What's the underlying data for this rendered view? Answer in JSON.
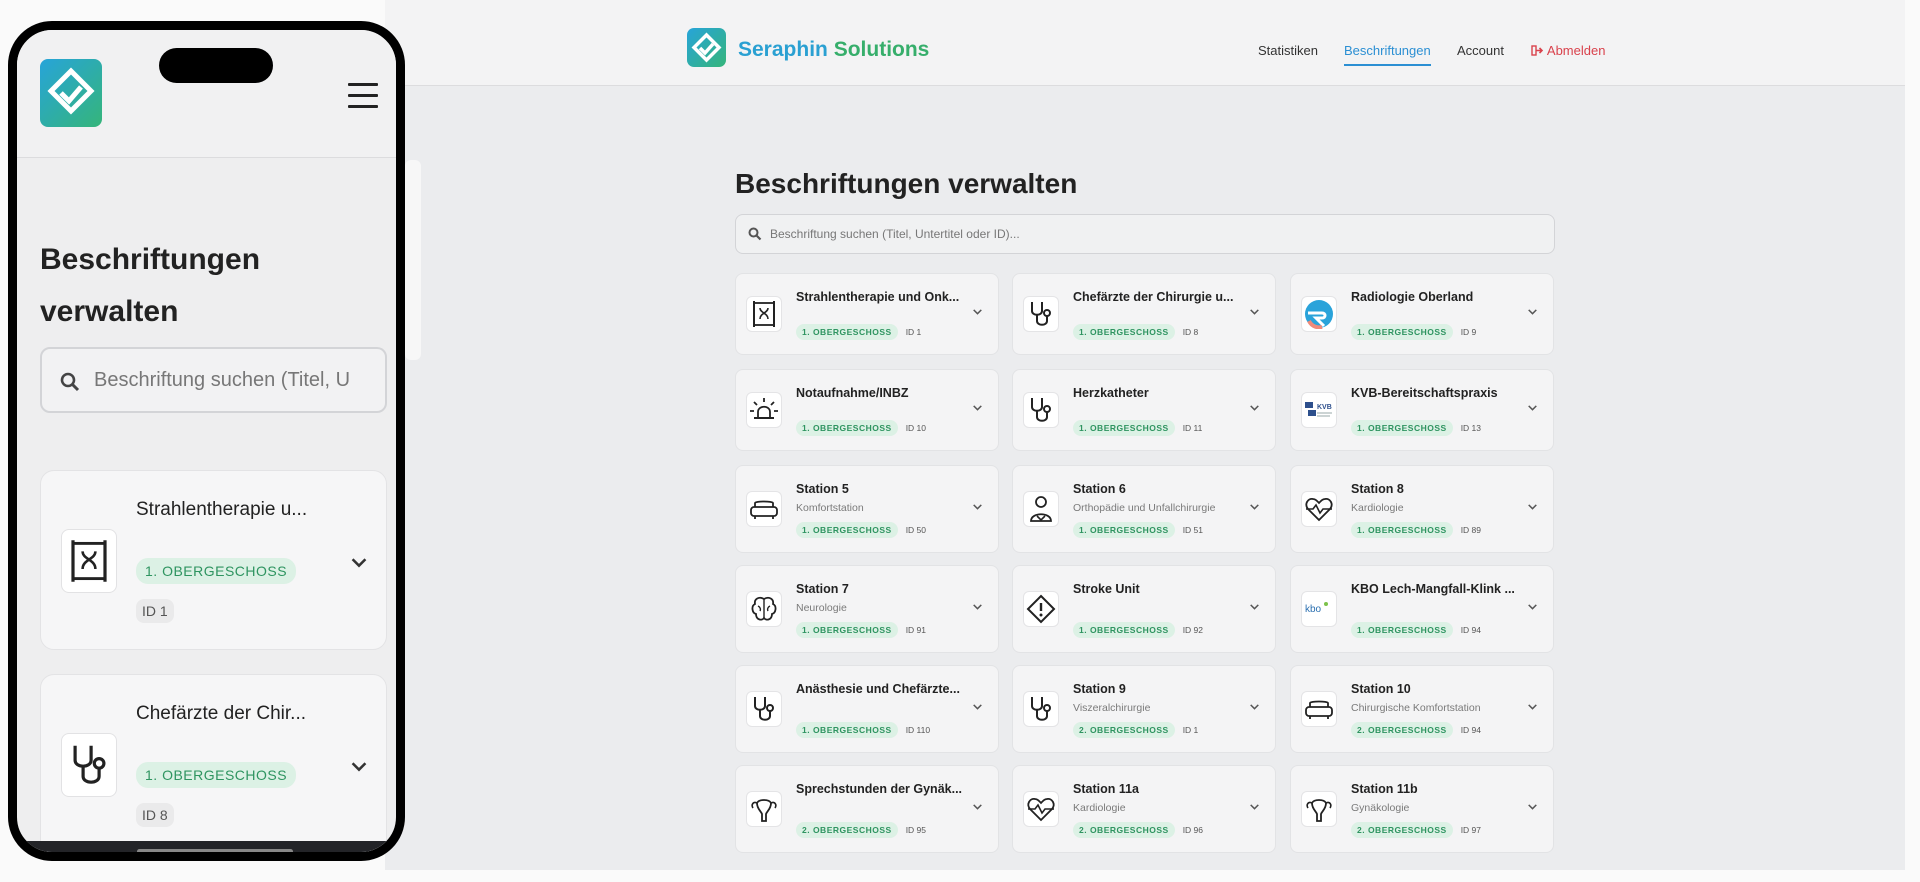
{
  "app": {
    "brand_part1": "Seraphin",
    "brand_part2": "Solutions"
  },
  "nav": {
    "statistiken": "Statistiken",
    "beschriftungen": "Beschriftungen",
    "account": "Account",
    "abmelden": "Abmelden"
  },
  "main": {
    "title": "Beschriftungen verwalten",
    "search_placeholder": "Beschriftung suchen (Titel, Untertitel oder ID)..."
  },
  "cards": [
    {
      "icon": "radiotherapy-icon",
      "title": "Strahlentherapie und Onk...",
      "subtitle": "",
      "floor": "1. OBERGESCHOSS",
      "id": "ID 1"
    },
    {
      "icon": "stethoscope-icon",
      "title": "Chefärzte der Chirurgie u...",
      "subtitle": "",
      "floor": "1. OBERGESCHOSS",
      "id": "ID 8"
    },
    {
      "icon": "radiologie-logo-icon",
      "title": "Radiologie Oberland",
      "subtitle": "",
      "floor": "1. OBERGESCHOSS",
      "id": "ID 9"
    },
    {
      "icon": "alarm-light-icon",
      "title": "Notaufnahme/INBZ",
      "subtitle": "",
      "floor": "1. OBERGESCHOSS",
      "id": "ID 10"
    },
    {
      "icon": "stethoscope-icon",
      "title": "Herzkatheter",
      "subtitle": "",
      "floor": "1. OBERGESCHOSS",
      "id": "ID 11"
    },
    {
      "icon": "kvb-logo-icon",
      "title": "KVB-Bereitschaftspraxis",
      "subtitle": "",
      "floor": "1. OBERGESCHOSS",
      "id": "ID 13"
    },
    {
      "icon": "sofa-icon",
      "title": "Station 5",
      "subtitle": "Komfortstation",
      "floor": "1. OBERGESCHOSS",
      "id": "ID 50"
    },
    {
      "icon": "patient-icon",
      "title": "Station 6",
      "subtitle": "Orthopädie und Unfallchirurgie",
      "floor": "1. OBERGESCHOSS",
      "id": "ID 51"
    },
    {
      "icon": "heart-pulse-icon",
      "title": "Station 8",
      "subtitle": "Kardiologie",
      "floor": "1. OBERGESCHOSS",
      "id": "ID 89"
    },
    {
      "icon": "brain-icon",
      "title": "Station 7",
      "subtitle": "Neurologie",
      "floor": "1. OBERGESCHOSS",
      "id": "ID 91"
    },
    {
      "icon": "warning-diamond-icon",
      "title": "Stroke Unit",
      "subtitle": "",
      "floor": "1. OBERGESCHOSS",
      "id": "ID 92"
    },
    {
      "icon": "kbo-logo-icon",
      "title": "KBO Lech-Mangfall-Klink ...",
      "subtitle": "",
      "floor": "1. OBERGESCHOSS",
      "id": "ID 94"
    },
    {
      "icon": "stethoscope-icon",
      "title": "Anästhesie und Chefärzte...",
      "subtitle": "",
      "floor": "1. OBERGESCHOSS",
      "id": "ID 110"
    },
    {
      "icon": "stethoscope-icon",
      "title": "Station 9",
      "subtitle": "Viszeralchirurgie",
      "floor": "2. OBERGESCHOSS",
      "id": "ID 1"
    },
    {
      "icon": "sofa-icon",
      "title": "Station 10",
      "subtitle": "Chirurgische Komfortstation",
      "floor": "2. OBERGESCHOSS",
      "id": "ID 94"
    },
    {
      "icon": "uterus-icon",
      "title": "Sprechstunden der Gynäk...",
      "subtitle": "",
      "floor": "2. OBERGESCHOSS",
      "id": "ID 95"
    },
    {
      "icon": "heart-pulse-icon",
      "title": "Station 11a",
      "subtitle": "Kardiologie",
      "floor": "2. OBERGESCHOSS",
      "id": "ID 96"
    },
    {
      "icon": "uterus-icon",
      "title": "Station 11b",
      "subtitle": "Gynäkologie",
      "floor": "2. OBERGESCHOSS",
      "id": "ID 97"
    }
  ],
  "mobile": {
    "title": "Beschriftungen verwalten",
    "search_placeholder": "Beschriftung suchen (Titel, U",
    "cards": [
      {
        "icon": "radiotherapy-icon",
        "title": "Strahlentherapie u...",
        "floor": "1. OBERGESCHOSS",
        "id": "ID 1"
      },
      {
        "icon": "stethoscope-icon",
        "title": "Chefärzte der Chir...",
        "floor": "1. OBERGESCHOSS",
        "id": "ID 8"
      }
    ]
  },
  "colors": {
    "accent_blue": "#2b8fd3",
    "brand_green": "#36ae6b",
    "tag_bg": "#dcf1e5",
    "tag_text": "#2e9460",
    "logout_red": "#d9424c"
  }
}
